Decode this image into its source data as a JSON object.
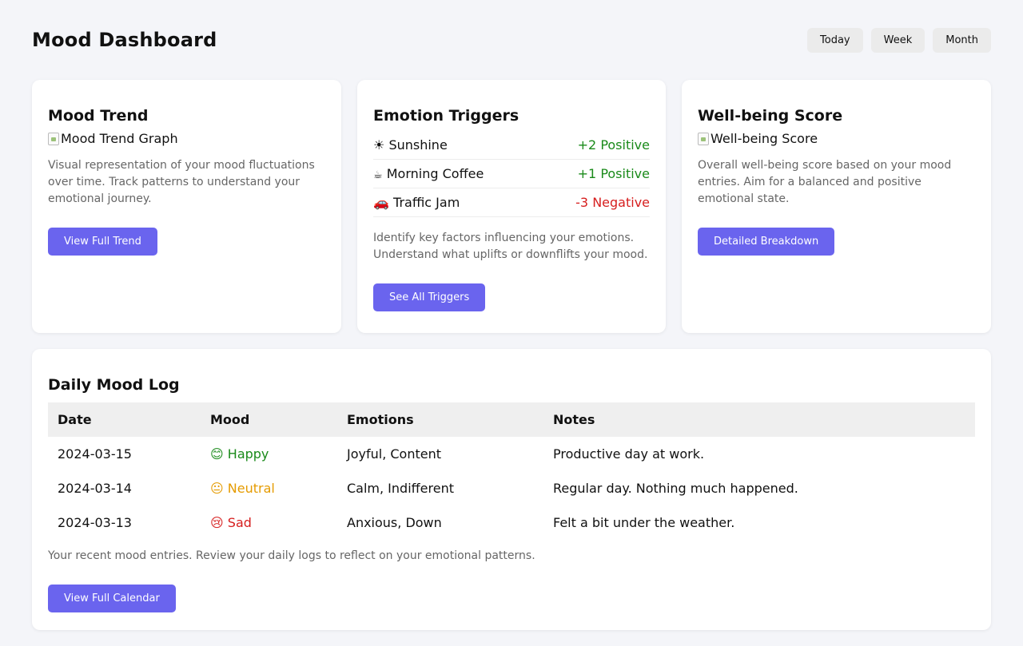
{
  "header": {
    "title": "Mood Dashboard",
    "periods": [
      "Today",
      "Week",
      "Month"
    ]
  },
  "mood_trend": {
    "title": "Mood Trend",
    "image_alt": "Mood Trend Graph",
    "description": "Visual representation of your mood fluctuations over time. Track patterns to understand your emotional journey.",
    "button": "View Full Trend"
  },
  "triggers": {
    "title": "Emotion Triggers",
    "items": [
      {
        "icon": "sun-icon",
        "glyph": "☀",
        "name": "Sunshine",
        "impact": "+2 Positive",
        "type": "positive"
      },
      {
        "icon": "coffee-icon",
        "glyph": "☕",
        "name": "Morning Coffee",
        "impact": "+1 Positive",
        "type": "positive"
      },
      {
        "icon": "car-icon",
        "glyph": "🚗",
        "name": "Traffic Jam",
        "impact": "-3 Negative",
        "type": "negative"
      }
    ],
    "description": "Identify key factors influencing your emotions. Understand what uplifts or downflifts your mood.",
    "button": "See All Triggers"
  },
  "wellbeing": {
    "title": "Well-being Score",
    "image_alt": "Well-being Score",
    "description": "Overall well-being score based on your mood entries. Aim for a balanced and positive emotional state.",
    "button": "Detailed Breakdown"
  },
  "log": {
    "title": "Daily Mood Log",
    "columns": [
      "Date",
      "Mood",
      "Emotions",
      "Notes"
    ],
    "rows": [
      {
        "date": "2024-03-15",
        "mood_icon": "😊",
        "mood": "Happy",
        "mood_type": "positive",
        "emotions": "Joyful, Content",
        "notes": "Productive day at work."
      },
      {
        "date": "2024-03-14",
        "mood_icon": "😐",
        "mood": "Neutral",
        "mood_type": "neutral",
        "emotions": "Calm, Indifferent",
        "notes": "Regular day. Nothing much happened."
      },
      {
        "date": "2024-03-13",
        "mood_icon": "😢",
        "mood": "Sad",
        "mood_type": "negative",
        "emotions": "Anxious, Down",
        "notes": "Felt a bit under the weather."
      }
    ],
    "description": "Your recent mood entries. Review your daily logs to reflect on your emotional patterns.",
    "button": "View Full Calendar"
  },
  "colors": {
    "accent": "#6a64ee",
    "positive": "#1a8a1a",
    "neutral": "#e59b00",
    "negative": "#d61e1e"
  }
}
